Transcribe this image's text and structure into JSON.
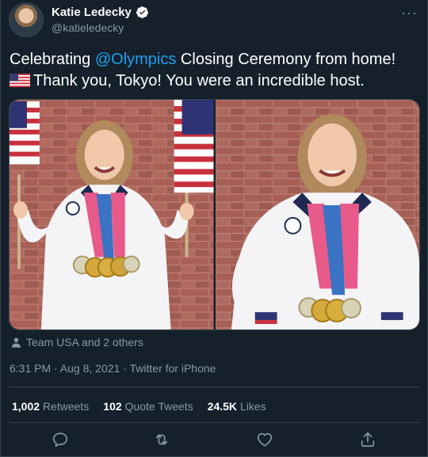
{
  "author": {
    "display_name": "Katie Ledecky",
    "handle": "@katieledecky",
    "verified_icon": "verified-badge-icon",
    "more_label": "···"
  },
  "tweet": {
    "text_part1": "Celebrating ",
    "mention": "@Olympics",
    "text_part2": " Closing Ceremony from home!",
    "line2": "Thank you, Tokyo! You were an incredible host.",
    "flag_icon": "us-flag-icon"
  },
  "media": {
    "photos": [
      "photo-with-flags",
      "photo-hands-on-hips"
    ]
  },
  "tagged_text": "Team USA and 2 others",
  "meta": "6:31 PM · Aug 8, 2021 · Twitter for iPhone",
  "stats": {
    "retweets_count": "1,002",
    "retweets_label": "Retweets",
    "quotes_count": "102",
    "quotes_label": "Quote Tweets",
    "likes_count": "24.5K",
    "likes_label": "Likes"
  },
  "actions": [
    "reply-icon",
    "retweet-icon",
    "like-icon",
    "share-icon"
  ],
  "colors": {
    "background": "#15202b",
    "accent": "#1da1f2",
    "secondary_text": "#8899a6",
    "border": "#38444d"
  }
}
